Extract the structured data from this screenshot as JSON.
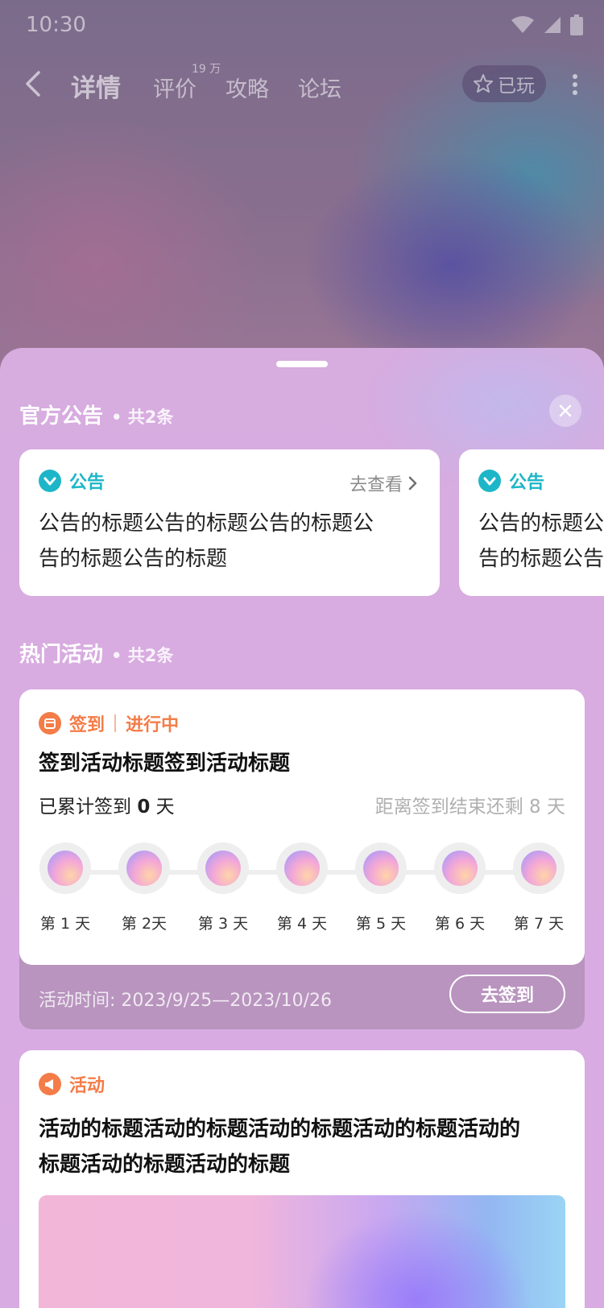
{
  "status_bar": {
    "time": "10:30"
  },
  "nav": {
    "tabs": [
      {
        "label": "详情",
        "active": true
      },
      {
        "label": "评价",
        "badge": "19 万"
      },
      {
        "label": "攻略"
      },
      {
        "label": "论坛"
      }
    ],
    "played_label": "已玩"
  },
  "announcements": {
    "title": "官方公告",
    "count": "• 共2条",
    "cards": [
      {
        "label": "公告",
        "more": "去查看",
        "text_line1": "公告的标题公告的标题公告的标题公",
        "text_line2": "告的标题公告的标题"
      },
      {
        "label": "公告",
        "text_line1": "公告的标题公告的标题公告的标题公",
        "text_line2": "告的标题公告的标题"
      }
    ]
  },
  "activities": {
    "title": "热门活动",
    "count": "• 共2条",
    "signin": {
      "tag": "签到",
      "status": "进行中",
      "title": "签到活动标题签到活动标题",
      "accumulated_prefix": "已累计签到 ",
      "accumulated_days": "0",
      "accumulated_suffix": " 天",
      "remaining": "距离签到结束还剩 8 天",
      "days": [
        "第 1 天",
        "第 2天",
        "第 3 天",
        "第 4 天",
        "第 5 天",
        "第 6 天",
        "第 7 天"
      ],
      "time": "活动时间: 2023/9/25—2023/10/26",
      "button": "去签到"
    },
    "activity": {
      "tag": "活动",
      "title_line1": "活动的标题活动的标题活动的标题活动的标题活动的",
      "title_line2": "标题活动的标题活动的标题"
    }
  },
  "colors": {
    "accent_teal": "#1db6c8",
    "accent_orange": "#f47c48",
    "sheet_bg": "#d8abe1"
  }
}
